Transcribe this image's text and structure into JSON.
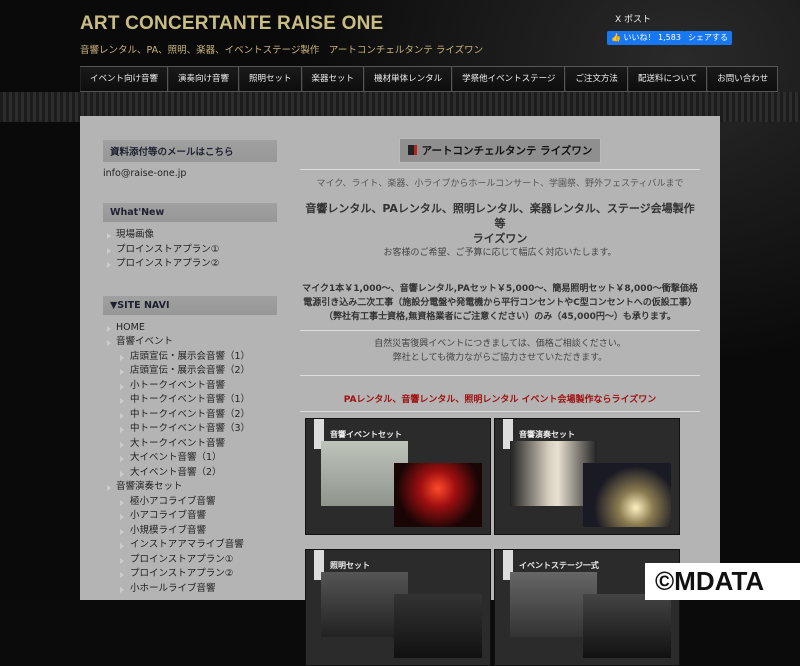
{
  "header": {
    "title": "ART CONCERTANTE RAISE ONE",
    "subtitle": "音響レンタル、PA、照明、楽器、イベントステージ製作　アートコンチェルタンテ ライズワン",
    "x_post": "X ポスト",
    "like_label": "👍 いいね！ 1,583",
    "share_label": "シェアする"
  },
  "nav": [
    "イベント向け音響",
    "演奏向け音響",
    "照明セット",
    "楽器セット",
    "機材単体レンタル",
    "学祭他イベントステージ",
    "ご注文方法",
    "配送料について",
    "お問い合わせ"
  ],
  "sidebar": {
    "mail_heading": "資料添付等のメールはこちら",
    "email": "info@raise-one.jp",
    "news_heading": "What'New",
    "news": [
      "現場画像",
      "プロインストアプラン①",
      "プロインストアプラン②"
    ],
    "navi_heading": "▼SITE NAVI",
    "navi": [
      {
        "t": "HOME",
        "s": 0
      },
      {
        "t": "音響イベント",
        "s": 0
      },
      {
        "t": "店頭宣伝・展示会音響（1）",
        "s": 1
      },
      {
        "t": "店頭宣伝・展示会音響（2）",
        "s": 1
      },
      {
        "t": "小トークイベント音響",
        "s": 1
      },
      {
        "t": "中トークイベント音響（1）",
        "s": 1
      },
      {
        "t": "中トークイベント音響（2）",
        "s": 1
      },
      {
        "t": "中トークイベント音響（3）",
        "s": 1
      },
      {
        "t": "大トークイベント音響",
        "s": 1
      },
      {
        "t": "大イベント音響（1）",
        "s": 1
      },
      {
        "t": "大イベント音響（2）",
        "s": 1
      },
      {
        "t": "音響演奏セット",
        "s": 0
      },
      {
        "t": "極小アコライブ音響",
        "s": 1
      },
      {
        "t": "小アコライブ音響",
        "s": 1
      },
      {
        "t": "小規模ライブ音響",
        "s": 1
      },
      {
        "t": "インストアアマライブ音響",
        "s": 1
      },
      {
        "t": "プロインストアプラン①",
        "s": 1
      },
      {
        "t": "プロインストアプラン②",
        "s": 1
      },
      {
        "t": "小ホールライブ音響",
        "s": 1
      }
    ]
  },
  "main": {
    "logo": "アートコンチェルタンテ ライズワン",
    "intro": "マイク、ライト、楽器、小ライブからホールコンサート、学園祭、野外フェスティバルまで",
    "headline1": "音響レンタル、PAレンタル、照明レンタル、楽器レンタル、ステージ会場製作 等",
    "headline2": "ライズワン",
    "tagline": "お客様のご希望、ご予算に応じて幅広く対応いたします。",
    "price1": "マイク1本￥1,000～、音響レンタル,PAセット￥5,000～、簡易照明セット￥8,000～衝撃価格",
    "price2": "電源引き込み二次工事（施設分電盤や発電機から平行コンセントやC型コンセントへの仮設工事）",
    "price3": "（弊社有工事士資格,無資格業者にご注意ください）のみ（45,000円～）も承ります。",
    "disaster1": "自然災害復興イベントにつきましては、価格ご相談ください。",
    "disaster2": "弊社としても微力ながらご協力させていただきます。",
    "red_line": "PAレンタル、音響レンタル、照明レンタル イベント会場製作ならライズワン",
    "cards": [
      "音響イベントセット",
      "音響演奏セット",
      "照明セット",
      "イベントステージ一式"
    ]
  },
  "watermark": "©MDATA"
}
